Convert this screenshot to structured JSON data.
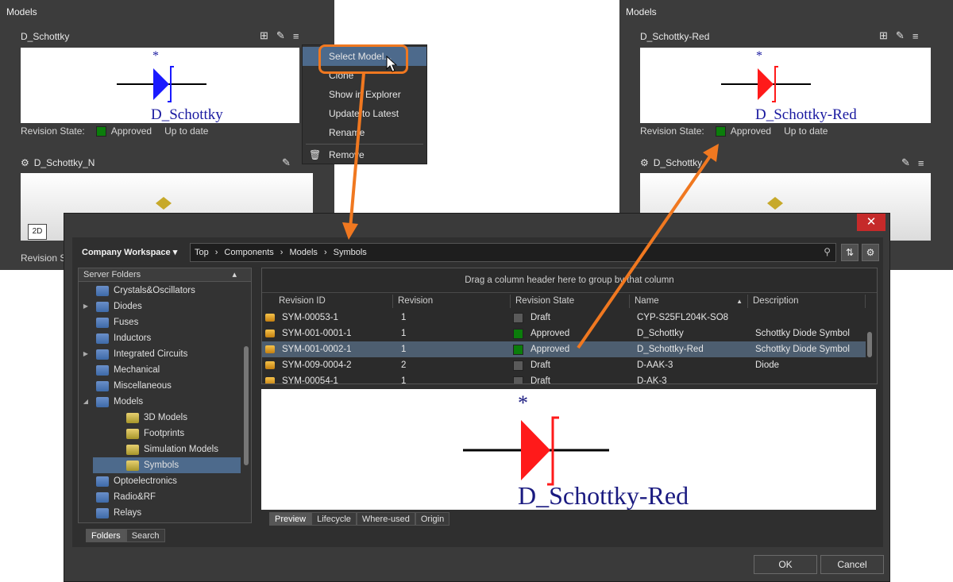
{
  "left_panel": {
    "title": "Models",
    "model1": {
      "name": "D_Schottky",
      "symbol_label": "D_Schottky",
      "designator": "*",
      "rev_label": "Revision State:",
      "rev_state": "Approved",
      "rev_status": "Up to date"
    },
    "model2": {
      "name": "D_Schottky_N",
      "badge": "2D",
      "rev_label": "Revision St"
    }
  },
  "context_menu": {
    "items": [
      "Select Model...",
      "Clone",
      "Show in Explorer",
      "Update to Latest",
      "Rename",
      "Remove"
    ]
  },
  "right_panel": {
    "title": "Models",
    "model1": {
      "name": "D_Schottky-Red",
      "symbol_label": "D_Schottky-Red",
      "designator": "*",
      "rev_label": "Revision State:",
      "rev_state": "Approved",
      "rev_status": "Up to date"
    },
    "model2": {
      "name": "D_Schottky"
    }
  },
  "dialog": {
    "close": "✕",
    "workspace": "Company Workspace ▾",
    "breadcrumb": [
      "Top",
      "Components",
      "Models",
      "Symbols"
    ],
    "tree_header": "Server Folders",
    "tree_items": [
      {
        "label": "Crystals&Oscillators",
        "expand": "",
        "indent": 0,
        "kind": "folder"
      },
      {
        "label": "Diodes",
        "expand": "▶",
        "indent": 0,
        "kind": "folder"
      },
      {
        "label": "Fuses",
        "expand": "",
        "indent": 0,
        "kind": "folder"
      },
      {
        "label": "Inductors",
        "expand": "",
        "indent": 0,
        "kind": "folder"
      },
      {
        "label": "Integrated Circuits",
        "expand": "▶",
        "indent": 0,
        "kind": "folder"
      },
      {
        "label": "Mechanical",
        "expand": "",
        "indent": 0,
        "kind": "folder"
      },
      {
        "label": "Miscellaneous",
        "expand": "",
        "indent": 0,
        "kind": "folder"
      },
      {
        "label": "Models",
        "expand": "◢",
        "indent": 0,
        "kind": "folder"
      },
      {
        "label": "3D Models",
        "expand": "",
        "indent": 1,
        "kind": "model"
      },
      {
        "label": "Footprints",
        "expand": "",
        "indent": 1,
        "kind": "model"
      },
      {
        "label": "Simulation Models",
        "expand": "",
        "indent": 1,
        "kind": "model"
      },
      {
        "label": "Symbols",
        "expand": "",
        "indent": 1,
        "kind": "model",
        "selected": true
      },
      {
        "label": "Optoelectronics",
        "expand": "",
        "indent": 0,
        "kind": "folder"
      },
      {
        "label": "Radio&RF",
        "expand": "",
        "indent": 0,
        "kind": "folder"
      },
      {
        "label": "Relays",
        "expand": "",
        "indent": 0,
        "kind": "folder"
      }
    ],
    "tree_tabs": [
      "Folders",
      "Search"
    ],
    "group_hint": "Drag a column header here to group by that column",
    "columns": [
      "Revision ID",
      "Revision",
      "Revision State",
      "Name",
      "Description"
    ],
    "rows": [
      {
        "id": "SYM-00053-1",
        "rev": "1",
        "state": "Draft",
        "state_color": "grey",
        "name": "CYP-S25FL204K-SO8",
        "desc": ""
      },
      {
        "id": "SYM-001-0001-1",
        "rev": "1",
        "state": "Approved",
        "state_color": "green",
        "name": "D_Schottky",
        "desc": "Schottky Diode Symbol"
      },
      {
        "id": "SYM-001-0002-1",
        "rev": "1",
        "state": "Approved",
        "state_color": "green",
        "name": "D_Schottky-Red",
        "desc": "Schottky Diode Symbol",
        "selected": true
      },
      {
        "id": "SYM-009-0004-2",
        "rev": "2",
        "state": "Draft",
        "state_color": "grey",
        "name": "D-AAK-3",
        "desc": "Diode"
      },
      {
        "id": "SYM-00054-1",
        "rev": "1",
        "state": "Draft",
        "state_color": "grey",
        "name": "D-AK-3",
        "desc": ""
      }
    ],
    "preview": {
      "designator": "*",
      "label": "D_Schottky-Red"
    },
    "preview_tabs": [
      "Preview",
      "Lifecycle",
      "Where-used",
      "Origin"
    ],
    "ok": "OK",
    "cancel": "Cancel"
  },
  "colors": {
    "accent_orange": "#f07820",
    "selection": "#4d6a8c",
    "approved_green": "#0b7d0b",
    "diode_blue": "#1a1aff",
    "diode_red": "#ff1a1a"
  }
}
